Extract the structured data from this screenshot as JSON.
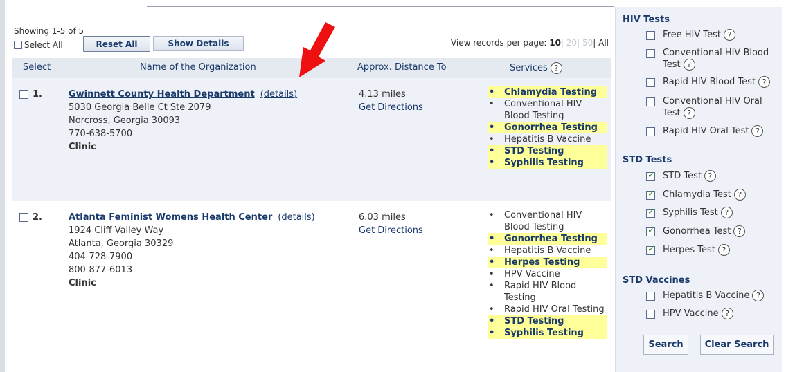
{
  "toolbar": {
    "showing": "Showing 1-5 of 5",
    "select_all": "Select All",
    "reset_all": "Reset All",
    "show_details": "Show Details",
    "per_page_label": "View records per page:",
    "per_page_options": [
      "10",
      "20",
      "50",
      "All"
    ],
    "per_page_selected": "10"
  },
  "columns": {
    "select": "Select",
    "name": "Name of the Organization",
    "distance": "Approx. Distance To",
    "services": "Services"
  },
  "results": [
    {
      "number": "1.",
      "name": "Gwinnett County Health Department",
      "details_link": "(details)",
      "address1": "5030 Georgia Belle Ct Ste 2079",
      "address2": "Norcross, Georgia 30093",
      "phones": [
        "770-638-5700"
      ],
      "type": "Clinic",
      "distance": "4.13 miles",
      "directions": "Get Directions",
      "services": [
        {
          "label": "Chlamydia Testing",
          "highlight": true
        },
        {
          "label": "Conventional HIV Blood Testing",
          "highlight": false
        },
        {
          "label": "Gonorrhea Testing",
          "highlight": true
        },
        {
          "label": "Hepatitis B Vaccine",
          "highlight": false
        },
        {
          "label": "STD Testing",
          "highlight": true
        },
        {
          "label": "Syphilis Testing",
          "highlight": true
        }
      ]
    },
    {
      "number": "2.",
      "name": "Atlanta Feminist Womens Health Center",
      "details_link": "(details)",
      "address1": "1924 Cliff Valley Way",
      "address2": "Atlanta, Georgia 30329",
      "phones": [
        "404-728-7900",
        "800-877-6013"
      ],
      "type": "Clinic",
      "distance": "6.03 miles",
      "directions": "Get Directions",
      "services": [
        {
          "label": "Conventional HIV Blood Testing",
          "highlight": false
        },
        {
          "label": "Gonorrhea Testing",
          "highlight": true
        },
        {
          "label": "Hepatitis B Vaccine",
          "highlight": false
        },
        {
          "label": "Herpes Testing",
          "highlight": true
        },
        {
          "label": "HPV Vaccine",
          "highlight": false
        },
        {
          "label": "Rapid HIV Blood Testing",
          "highlight": false
        },
        {
          "label": "Rapid HIV Oral Testing",
          "highlight": false
        },
        {
          "label": "STD Testing",
          "highlight": true
        },
        {
          "label": "Syphilis Testing",
          "highlight": true
        }
      ]
    }
  ],
  "sidebar": {
    "hiv_heading": "HIV Tests",
    "hiv": [
      {
        "label": "Free HIV Test",
        "checked": false
      },
      {
        "label": "Conventional HIV Blood Test",
        "checked": false
      },
      {
        "label": "Rapid HIV Blood Test",
        "checked": false
      },
      {
        "label": "Conventional HIV Oral Test",
        "checked": false
      },
      {
        "label": "Rapid HIV Oral Test",
        "checked": false
      }
    ],
    "std_heading": "STD Tests",
    "std": [
      {
        "label": "STD Test",
        "checked": true
      },
      {
        "label": "Chlamydia Test",
        "checked": true
      },
      {
        "label": "Syphilis Test",
        "checked": true
      },
      {
        "label": "Gonorrhea Test",
        "checked": true
      },
      {
        "label": "Herpes Test",
        "checked": true
      }
    ],
    "vac_heading": "STD Vaccines",
    "vaccines": [
      {
        "label": "Hepatitis B Vaccine",
        "checked": false
      },
      {
        "label": "HPV Vaccine",
        "checked": false
      }
    ],
    "search": "Search",
    "clear": "Clear Search"
  },
  "help_glyph": "?",
  "colors": {
    "link": "#1a3a6c",
    "highlight": "#ffff99",
    "row_alt": "#eef1f7",
    "arrow": "#ee1111"
  }
}
